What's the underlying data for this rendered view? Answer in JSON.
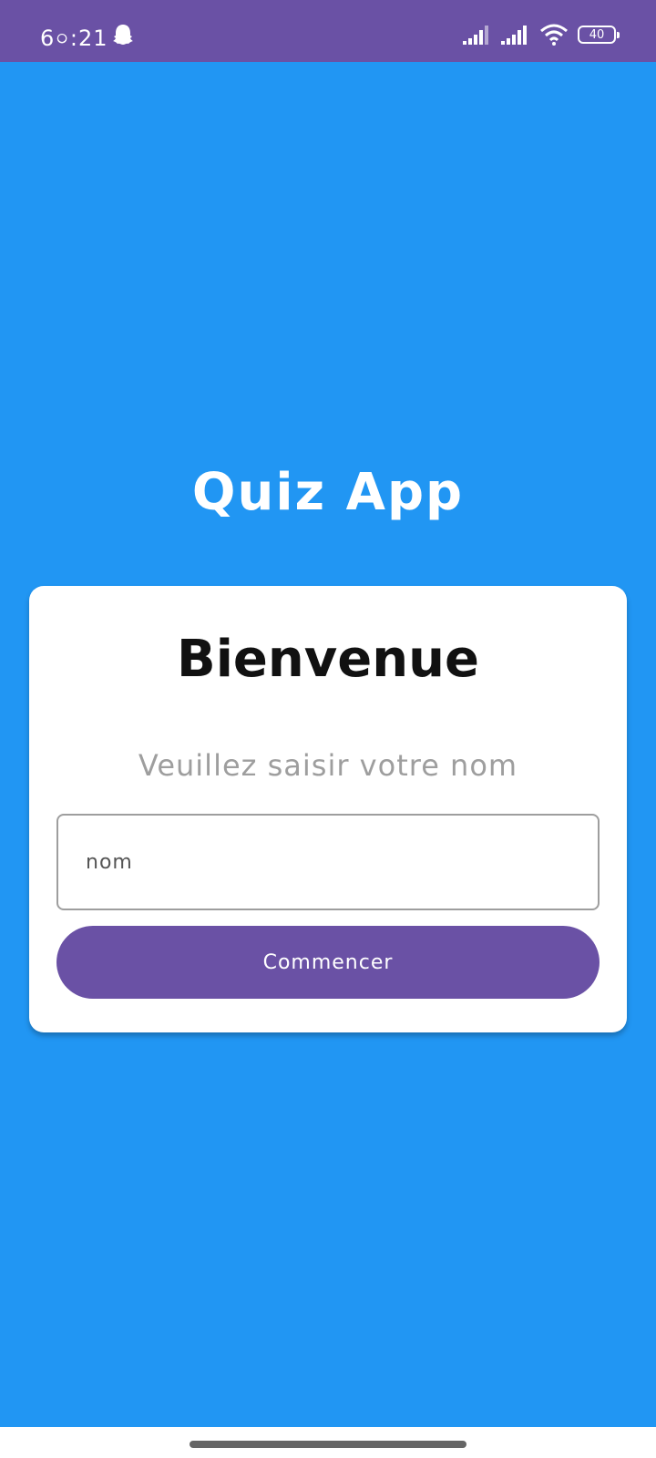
{
  "status_bar": {
    "time": "6০:21",
    "battery_level": "40",
    "icons": [
      "ghost-icon",
      "signal-icon",
      "signal-icon",
      "wifi-icon",
      "battery-icon"
    ]
  },
  "app": {
    "title": "Quiz App"
  },
  "card": {
    "title": "Bienvenue",
    "subtitle": "Veuillez saisir votre nom",
    "name_input": {
      "placeholder": "nom",
      "value": ""
    },
    "start_button_label": "Commencer"
  },
  "colors": {
    "background": "#2196F3",
    "status_bar": "#6A51A5",
    "button": "#6A51A5",
    "card": "#FFFFFF"
  }
}
